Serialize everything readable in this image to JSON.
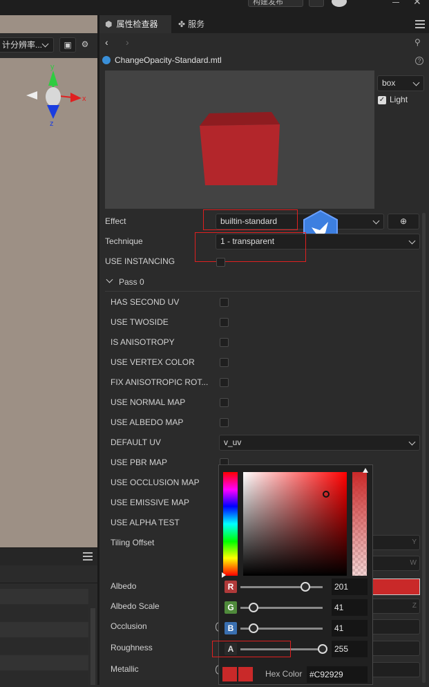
{
  "topbar": {
    "btn_label": "构建发布"
  },
  "scene": {
    "resolution_label": "计分辨率...",
    "axis_x": "x",
    "axis_y": "y",
    "axis_z": "z"
  },
  "inspector": {
    "tab_inspector": "属性检查器",
    "tab_services": "服务",
    "file_name": "ChangeOpacity-Standard.mtl",
    "preview": {
      "shape_select": "box",
      "light_label": "Light",
      "cube_color": "#b3262b"
    },
    "effect": {
      "label": "Effect",
      "value": "builtin-standard"
    },
    "technique": {
      "label": "Technique",
      "value": "1 - transparent"
    },
    "use_instancing": "USE INSTANCING",
    "pass_label": "Pass 0",
    "pass_props": [
      "HAS SECOND UV",
      "USE TWOSIDE",
      "IS ANISOTROPY",
      "USE VERTEX COLOR",
      "FIX ANISOTROPIC ROT...",
      "USE NORMAL MAP",
      "USE ALBEDO MAP",
      "DEFAULT UV",
      "USE PBR MAP",
      "USE OCCLUSION MAP",
      "USE EMISSIVE MAP",
      "USE ALPHA TEST",
      "Tiling Offset",
      "Albedo",
      "Albedo Scale",
      "Occlusion",
      "Roughness",
      "Metallic"
    ],
    "default_uv_value": "v_uv",
    "tiling_axes": [
      "Y",
      "W"
    ],
    "albedo_scale_axis": "Z"
  },
  "color_picker": {
    "r_label": "R",
    "g_label": "G",
    "b_label": "B",
    "a_label": "A",
    "r": "201",
    "g": "41",
    "b": "41",
    "a": "255",
    "hex_label": "Hex Color",
    "hex_value": "#C92929",
    "r_fraction": 0.788,
    "g_fraction": 0.161,
    "b_fraction": 0.161,
    "a_fraction": 1.0,
    "color": "#c92929"
  }
}
